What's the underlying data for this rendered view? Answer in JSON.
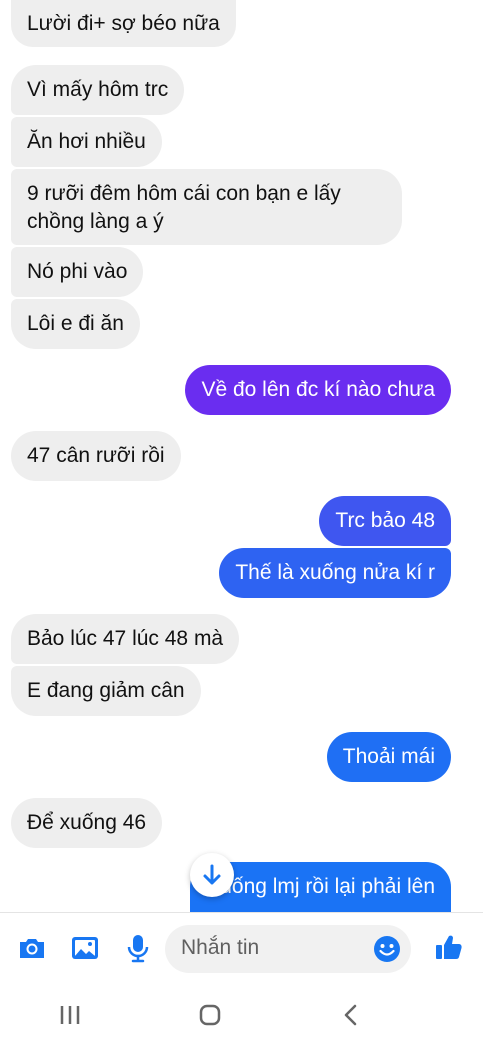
{
  "colors": {
    "incoming_bubble": "#eeeeee",
    "outgoing_gradient_top": "#6a2df0",
    "outgoing_gradient_bottom": "#1a73f5",
    "accent": "#1877f2"
  },
  "messages": [
    {
      "text": "Lười đi+ sợ béo nữa",
      "direction": "incoming"
    },
    {
      "text": "Vì mấy hôm trc",
      "direction": "incoming"
    },
    {
      "text": "Ăn hơi nhiều",
      "direction": "incoming"
    },
    {
      "text": "9 rưỡi đêm hôm cái con bạn e lấy chồng làng a ý",
      "direction": "incoming"
    },
    {
      "text": "Nó phi vào",
      "direction": "incoming"
    },
    {
      "text": "Lôi e đi ăn",
      "direction": "incoming"
    },
    {
      "text": "Về đo lên đc kí nào chưa",
      "direction": "outgoing"
    },
    {
      "text": "47 cân rưỡi rồi",
      "direction": "incoming"
    },
    {
      "text": "Trc bảo 48",
      "direction": "outgoing"
    },
    {
      "text": "Thế là xuống nửa kí r",
      "direction": "outgoing"
    },
    {
      "text": "Bảo lúc 47 lúc 48 mà",
      "direction": "incoming"
    },
    {
      "text": "E đang giảm cân",
      "direction": "incoming"
    },
    {
      "text": "Thoải mái",
      "direction": "outgoing"
    },
    {
      "text": "Để xuống 46",
      "direction": "incoming"
    },
    {
      "text": "Xuống lmj rồi lại phải lên",
      "direction": "outgoing"
    }
  ],
  "composer": {
    "placeholder": "Nhắn tin",
    "icons": [
      "camera-icon",
      "image-icon",
      "microphone-icon",
      "emoji-icon",
      "like-icon"
    ]
  },
  "navigation": {
    "icons": [
      "recent-apps-icon",
      "home-icon",
      "back-icon"
    ]
  },
  "scroll_button_icon": "arrow-down-icon"
}
